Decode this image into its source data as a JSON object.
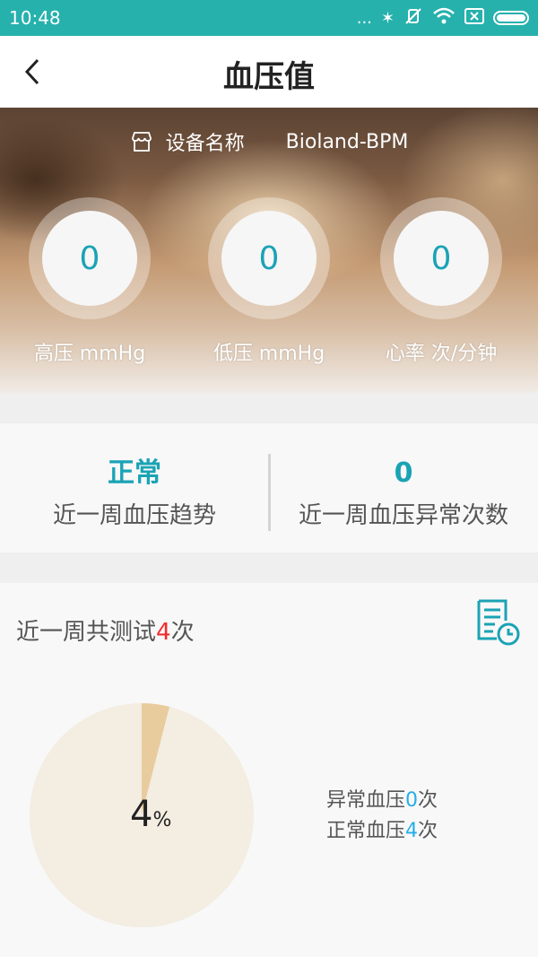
{
  "status_bar": {
    "time": "10:48",
    "dots": "..."
  },
  "header": {
    "title": "血压值"
  },
  "device": {
    "label": "设备名称",
    "name": "Bioland-BPM"
  },
  "metrics": [
    {
      "value": "0",
      "label": "高压 mmHg"
    },
    {
      "value": "0",
      "label": "低压 mmHg"
    },
    {
      "value": "0",
      "label": "心率 次/分钟"
    }
  ],
  "summary": {
    "trend_value": "正常",
    "trend_caption": "近一周血压趋势",
    "abnormal_value": "0",
    "abnormal_caption": "近一周血压异常次数"
  },
  "week": {
    "title_prefix": "近一周共测试",
    "count": "4",
    "title_suffix": "次",
    "percent": "4",
    "percent_sign": "%",
    "abnormal_prefix": "异常血压",
    "abnormal_count": "0",
    "normal_prefix": "正常血压",
    "normal_count": "4",
    "unit": "次"
  },
  "chart_data": {
    "type": "pie",
    "values": [
      4,
      96
    ],
    "colors": [
      "#e8cc9e",
      "#f3ede2"
    ]
  },
  "colors": {
    "accent": "#26b1ad",
    "value": "#1aa3b5",
    "highlight": "#f12d2d",
    "legend_number": "#24aeea"
  }
}
